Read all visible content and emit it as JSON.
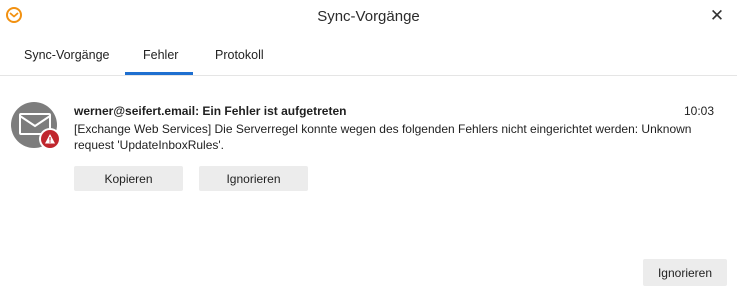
{
  "window": {
    "title": "Sync-Vorgänge",
    "close_icon": "close-icon",
    "app_icon": "app-logo-icon"
  },
  "tabs": [
    {
      "label": "Sync-Vorgänge",
      "active": false
    },
    {
      "label": "Fehler",
      "active": true
    },
    {
      "label": "Protokoll",
      "active": false
    }
  ],
  "error": {
    "title": "werner@seifert.email: Ein Fehler ist aufgetreten",
    "time": "10:03",
    "message": "[Exchange Web Services] Die Serverregel konnte wegen des folgenden Fehlers nicht eingerichtet werden: Unknown request 'UpdateInboxRules'.",
    "avatar_icon": "account-avatar-icon",
    "badge_icon": "warning-icon",
    "copy_label": "Kopieren",
    "ignore_label": "Ignorieren"
  },
  "footer": {
    "ignore_label": "Ignorieren"
  },
  "colors": {
    "accent": "#1e6fd0",
    "error": "#c0262d",
    "button_bg": "#ececec"
  }
}
